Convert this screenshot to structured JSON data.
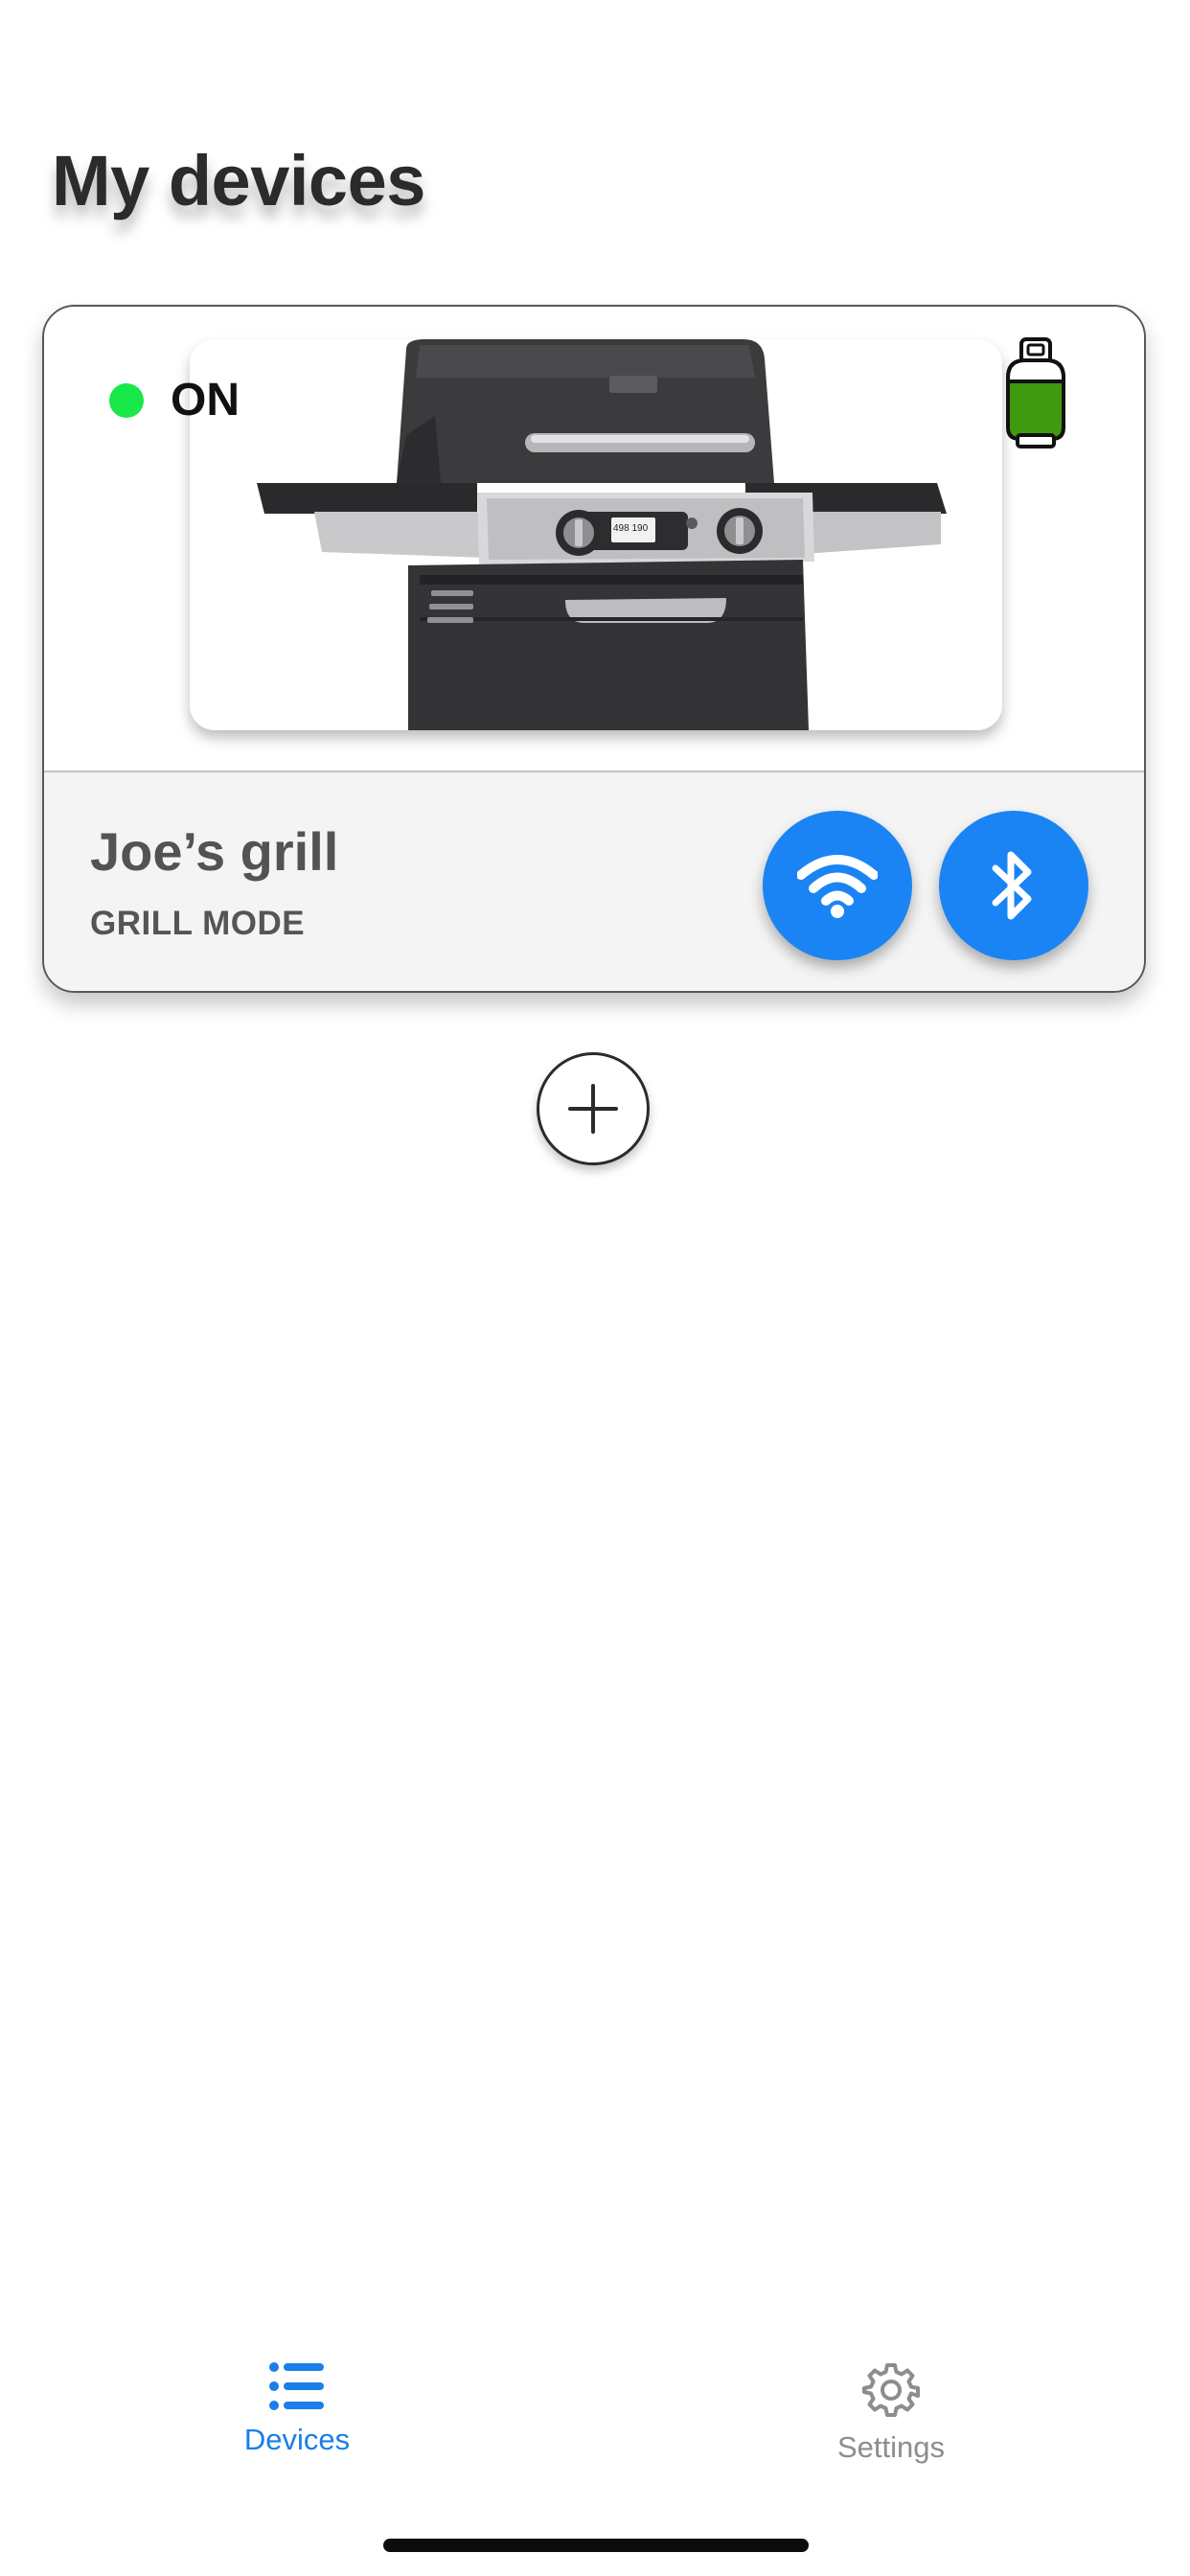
{
  "header": {
    "title": "My devices"
  },
  "device_card": {
    "status_label": "ON",
    "status_color": "#18e84a",
    "device_image": "gas-grill-image",
    "fuel_icon": "propane-tank-icon",
    "fuel_color": "#3f9a0f",
    "name": "Joe’s grill",
    "mode": "GRILL MODE",
    "wifi_button_icon": "wifi-icon",
    "bluetooth_button_icon": "bluetooth-icon",
    "button_color": "#1a84f4",
    "grill_display_text": "498 190"
  },
  "add_button": {
    "icon": "plus-icon"
  },
  "tab_bar": {
    "tabs": [
      {
        "label": "Devices",
        "icon": "list-icon",
        "active": true
      },
      {
        "label": "Settings",
        "icon": "gear-icon",
        "active": false
      }
    ],
    "active_color": "#1a7fe8",
    "inactive_color": "#8d8d8d"
  }
}
